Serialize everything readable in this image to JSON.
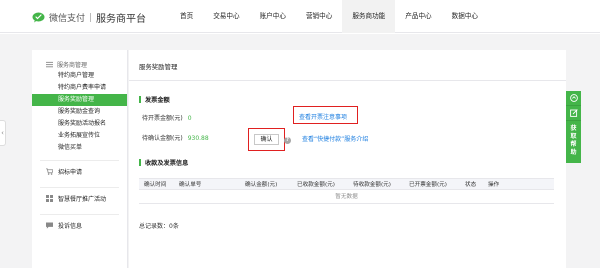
{
  "header": {
    "logo_text": "微信支付",
    "logo_sub": "服务商平台",
    "nav": [
      {
        "label": "首页"
      },
      {
        "label": "交易中心"
      },
      {
        "label": "账户中心"
      },
      {
        "label": "营销中心"
      },
      {
        "label": "服务商功能",
        "active": true
      },
      {
        "label": "产品中心"
      },
      {
        "label": "数据中心"
      }
    ]
  },
  "sidebar": {
    "group_title": "服务商管理",
    "items": [
      {
        "label": "特约商户管理"
      },
      {
        "label": "特约商户费率申请"
      },
      {
        "label": "服务奖励管理",
        "active": true
      },
      {
        "label": "服务奖励金查询"
      },
      {
        "label": "服务奖励活动报名"
      },
      {
        "label": "业务拓展宣传位"
      },
      {
        "label": "微信买单"
      }
    ],
    "singles": [
      {
        "label": "招标申请",
        "icon": "cart-icon"
      },
      {
        "label": "智慧餐厅推广活动",
        "icon": "grid-icon"
      },
      {
        "label": "投诉信息",
        "icon": "chat-icon"
      }
    ]
  },
  "main": {
    "page_title": "服务奖励管理",
    "invoice_section": "发票金额",
    "pending_invoice_label": "待开票金额(元)",
    "pending_invoice_value": "0",
    "pending_confirm_label": "待确认金额(元)",
    "pending_confirm_value": "930.88",
    "confirm_button": "确认",
    "invoice_notice_link": "查看开票注意事项",
    "quick_pay_link": "查看“快捷付款”服务介绍",
    "records_section": "收款及发票信息",
    "table_headers": [
      "确认时间",
      "确认单号",
      "确认金额(元)",
      "已收款金额(元)",
      "待收款金额(元)",
      "已开票金额(元)",
      "状态",
      "操作"
    ],
    "empty_text": "暂无数据",
    "total_text": "总记录数：0条"
  },
  "float_panel": {
    "label": "获取帮助"
  },
  "colors": {
    "brand_green": "#44b549",
    "link_blue": "#1a7de0",
    "highlight_red": "#e02020"
  }
}
